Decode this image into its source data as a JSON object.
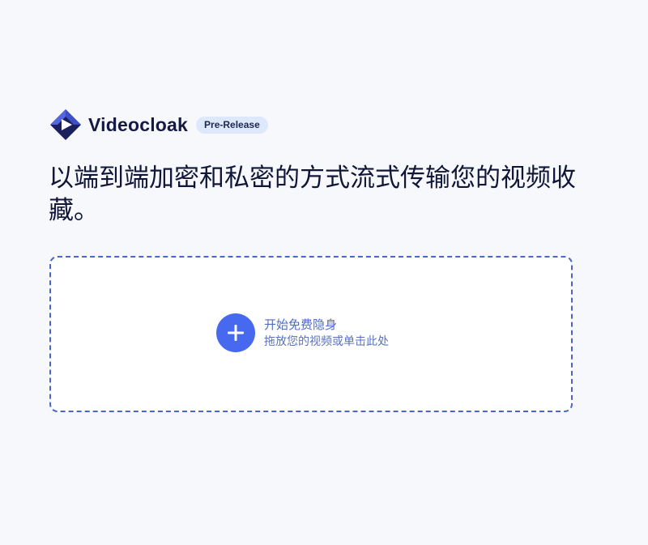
{
  "brand": {
    "name": "Videocloak",
    "badge": "Pre-Release",
    "logo_icon": "play-gem-icon",
    "colors": {
      "logo_dark": "#1b1f5e",
      "logo_light": "#4a5fd8",
      "badge_bg": "#dde8fb"
    }
  },
  "hero": {
    "headline": "以端到端加密和私密的方式流式传输您的视频收藏。"
  },
  "dropzone": {
    "title": "开始免费隐身",
    "subtitle": "拖放您的视频或单击此处",
    "icon": "plus-icon",
    "colors": {
      "border": "#4a66c9",
      "button": "#4669ef",
      "text": "#4f6cc4"
    }
  }
}
